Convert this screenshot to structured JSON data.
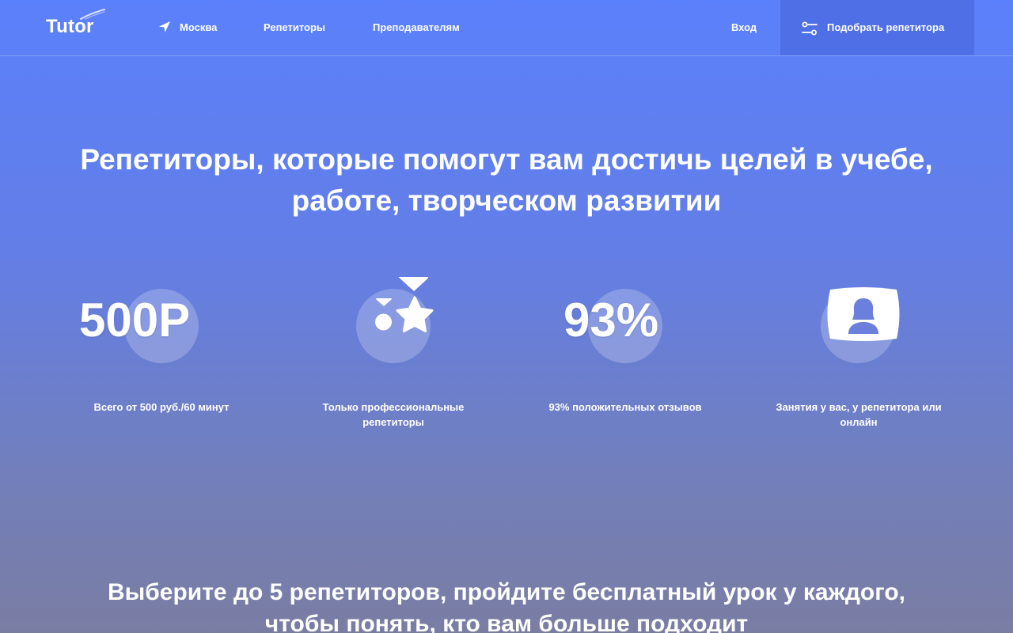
{
  "header": {
    "logo": "Tutor",
    "city": "Москва",
    "nav": [
      "Репетиторы",
      "Преподавателям"
    ],
    "login": "Вход",
    "cta_label": "Подобрать репетитора"
  },
  "hero": {
    "title": "Репетиторы, которые помогут вам достичь целей в учебе, работе, творческом развитии",
    "features": [
      {
        "big": "500Р",
        "icon": "",
        "caption": "Всего от 500 руб./60 минут"
      },
      {
        "big": "",
        "icon": "medal-star-icon",
        "caption": "Только профессиональные репетиторы"
      },
      {
        "big": "93%",
        "icon": "",
        "caption": "93% положительных отзывов"
      },
      {
        "big": "",
        "icon": "person-screen-icon",
        "caption": "Занятия у вас, у репетитора или онлайн"
      }
    ]
  },
  "bottom": {
    "title": "Выберите до 5 репетиторов, пройдите бесплатный урок у каждого, чтобы понять, кто вам больше подходит"
  },
  "colors": {
    "background_top": "#5b80fb",
    "background_bottom": "#7a7da3",
    "cta_background": "#4f6fe6",
    "text": "#ffffff"
  }
}
